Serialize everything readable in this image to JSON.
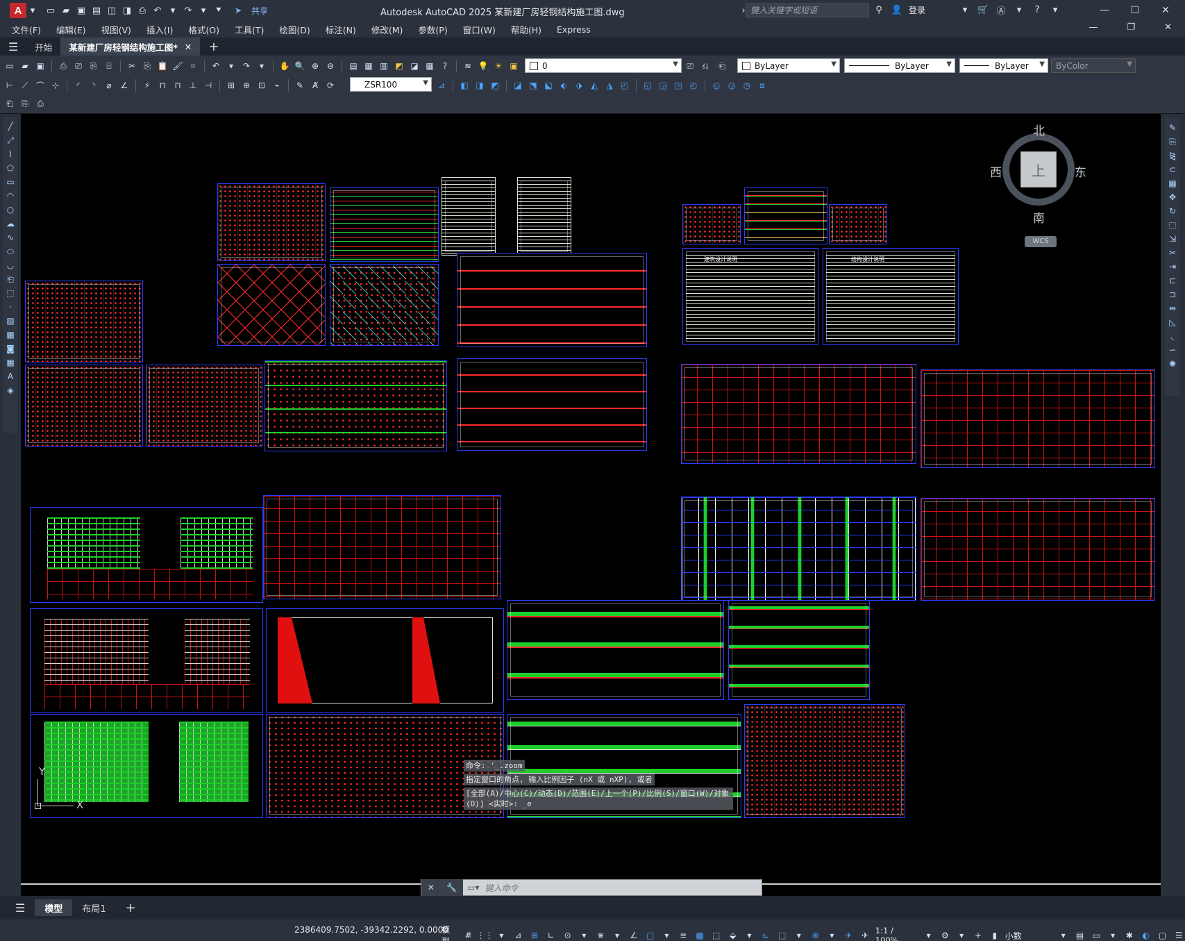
{
  "app": {
    "title": "Autodesk AutoCAD 2025    某新建厂房轻钢结构施工图.dwg",
    "logo": "A",
    "share_label": "共享",
    "search_placeholder": "键入关键字或短语",
    "login_label": "登录"
  },
  "menu": [
    "文件(F)",
    "编辑(E)",
    "视图(V)",
    "插入(I)",
    "格式(O)",
    "工具(T)",
    "绘图(D)",
    "标注(N)",
    "修改(M)",
    "参数(P)",
    "窗口(W)",
    "帮助(H)",
    "Express"
  ],
  "tabs": {
    "start": "开始",
    "active_file": "某新建厂房轻钢结构施工图*",
    "new_tab": "+"
  },
  "toolbar": {
    "layer_value": "0",
    "dimstyle_value": "ZSR100",
    "color_value": "ByLayer",
    "linetype_value": "ByLayer",
    "lineweight_value": "ByLayer",
    "plotstyle_value": "ByColor"
  },
  "viewcube": {
    "north": "北",
    "south": "南",
    "east": "东",
    "west": "西",
    "face": "上",
    "wcs_label": "WCS"
  },
  "ucs": {
    "x_label": "X",
    "y_label": "Y"
  },
  "command": {
    "history": [
      "命令: '_.zoom",
      "指定窗口的角点, 输入比例因子 (nX 或 nXP), 或者",
      "[全部(A)/中心(C)/动态(D)/范围(E)/上一个(P)/比例(S)/窗口(W)/对象(O)] <实时>: _e"
    ],
    "placeholder": "键入命令"
  },
  "layout_tabs": {
    "model": "模型",
    "layout1": "布局1",
    "add": "+"
  },
  "status": {
    "coordinates": "2386409.7502, -39342.2292, 0.0000",
    "space": "模型",
    "scale": "1:1 / 100%",
    "units": "小数"
  },
  "drawing_sheets": {
    "design_notes_1": "建筑设计说明",
    "design_notes_2": "结构设计说明"
  }
}
